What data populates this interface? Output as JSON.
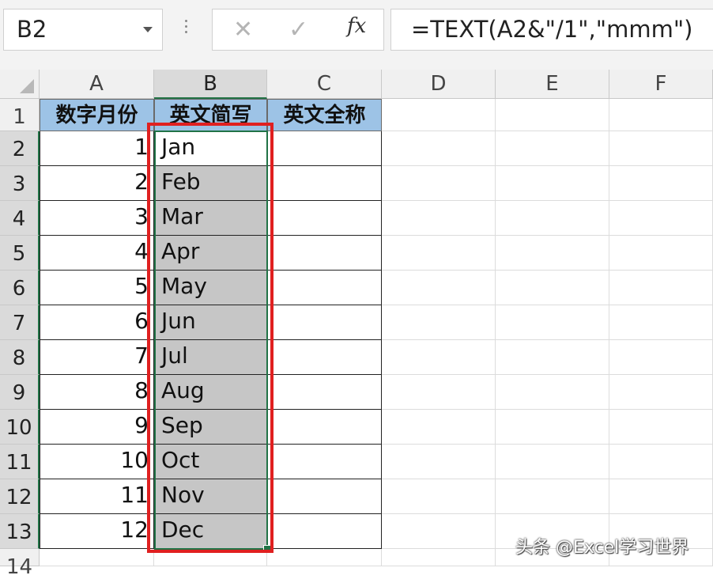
{
  "formula_bar": {
    "name_box": "B2",
    "cancel_symbol": "✕",
    "enter_symbol": "✓",
    "fx_symbol": "fx",
    "formula": "=TEXT(A2&\"/1\",\"mmm\")"
  },
  "columns": [
    "A",
    "B",
    "C",
    "D",
    "E",
    "F"
  ],
  "selected_column": "B",
  "rows": [
    "1",
    "2",
    "3",
    "4",
    "5",
    "6",
    "7",
    "8",
    "9",
    "10",
    "11",
    "12",
    "13",
    "14"
  ],
  "headers": {
    "a1": "数字月份",
    "b1": "英文简写",
    "c1": "英文全称"
  },
  "data_rows": [
    {
      "number": "1",
      "abbr": "Jan"
    },
    {
      "number": "2",
      "abbr": "Feb"
    },
    {
      "number": "3",
      "abbr": "Mar"
    },
    {
      "number": "4",
      "abbr": "Apr"
    },
    {
      "number": "5",
      "abbr": "May"
    },
    {
      "number": "6",
      "abbr": "Jun"
    },
    {
      "number": "7",
      "abbr": "Jul"
    },
    {
      "number": "8",
      "abbr": "Aug"
    },
    {
      "number": "9",
      "abbr": "Sep"
    },
    {
      "number": "10",
      "abbr": "Oct"
    },
    {
      "number": "11",
      "abbr": "Nov"
    },
    {
      "number": "12",
      "abbr": "Dec"
    }
  ],
  "watermark": "头条 @Excel学习世界",
  "colors": {
    "header_fill": "#9dc3e6",
    "selection_fill": "#c6c6c6",
    "selection_border": "#217346",
    "highlight_box": "#e02020"
  }
}
